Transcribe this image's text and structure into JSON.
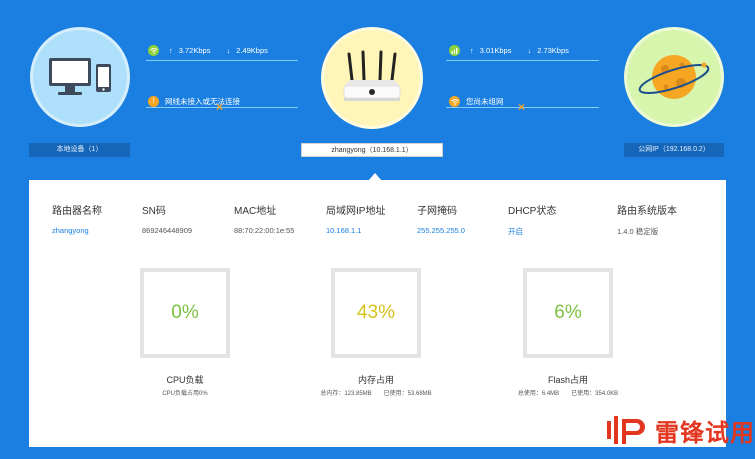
{
  "topology": {
    "local_label": "本地设备（1）",
    "router_label": "zhangyong（10.168.1.1）",
    "public_label": "公网IP（192.168.0.2）",
    "left_link": {
      "up": "3.72Kbps",
      "down": "2.49Kbps",
      "status": "网线未接入或无法连接"
    },
    "right_link": {
      "up": "3.01Kbps",
      "down": "2.73Kbps",
      "status": "您尚未组网"
    },
    "up_arrow": "↑",
    "down_arrow": "↓"
  },
  "info": [
    {
      "header": "路由器名称",
      "value": "zhangyong"
    },
    {
      "header": "SN码",
      "value": "869246448909"
    },
    {
      "header": "MAC地址",
      "value": "88:70:22:00:1e:55"
    },
    {
      "header": "局域网IP地址",
      "value": "10.168.1.1"
    },
    {
      "header": "子网掩码",
      "value": "255.255.255.0"
    },
    {
      "header": "DHCP状态",
      "value": "开启"
    },
    {
      "header": "路由系统版本",
      "value": "1.4.0 稳定版"
    }
  ],
  "gauges": [
    {
      "value": "0%",
      "title": "CPU负载",
      "sub": "CPU负载占用0%",
      "color": "#7dc242"
    },
    {
      "value": "43%",
      "title": "内存占用",
      "sub": "总内存：123.85MB　　已使用：53.68MB",
      "color": "#d5c21a"
    },
    {
      "value": "6%",
      "title": "Flash占用",
      "sub": "总使用：6.4MB　　已使用：354.0KB",
      "color": "#7dc242"
    }
  ],
  "logo_text": "雷锋试用",
  "colors": {
    "background": "#1a7fe0",
    "accent_orange": "#f5a623",
    "accent_green": "#8bd13b",
    "logo_red": "#e2361f"
  }
}
